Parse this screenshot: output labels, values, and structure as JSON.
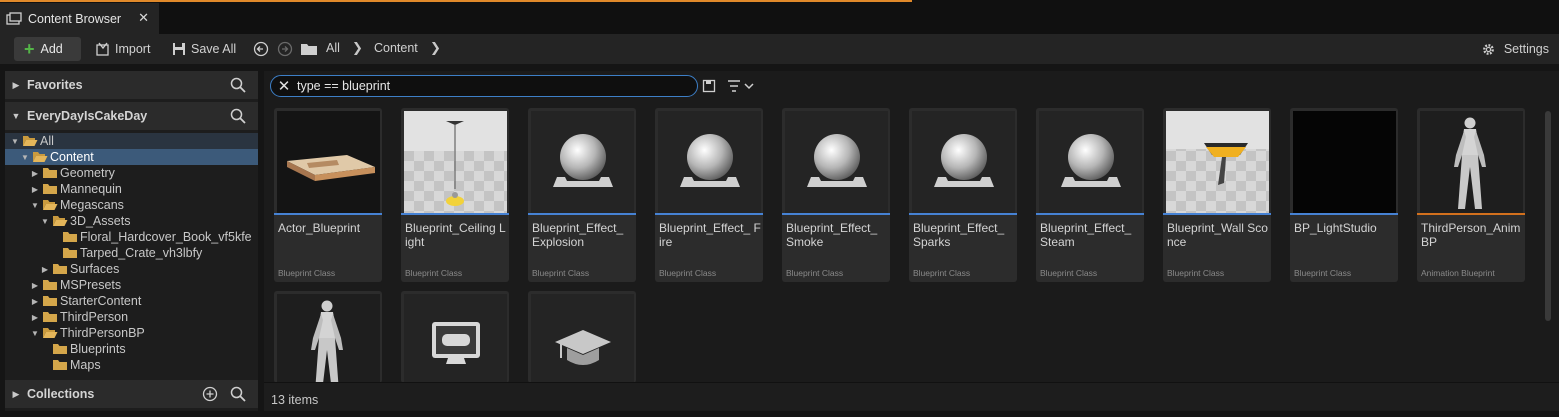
{
  "tab": {
    "title": "Content Browser",
    "close": "✕"
  },
  "toolbar": {
    "add": "Add",
    "import": "Import",
    "save_all": "Save All",
    "breadcrumb": [
      "All",
      "Content"
    ],
    "settings": "Settings"
  },
  "left": {
    "favorites": "Favorites",
    "project": "EveryDayIsCakeDay",
    "collections": "Collections",
    "tree": [
      {
        "label": "All",
        "depth": 0,
        "open": true
      },
      {
        "label": "Content",
        "depth": 1,
        "open": true
      },
      {
        "label": "Geometry",
        "depth": 2,
        "open": false
      },
      {
        "label": "Mannequin",
        "depth": 2,
        "open": false
      },
      {
        "label": "Megascans",
        "depth": 2,
        "open": true
      },
      {
        "label": "3D_Assets",
        "depth": 3,
        "open": true
      },
      {
        "label": "Floral_Hardcover_Book_vf5kfe",
        "depth": 4,
        "open": null
      },
      {
        "label": "Tarped_Crate_vh3lbfy",
        "depth": 4,
        "open": null
      },
      {
        "label": "Surfaces",
        "depth": 3,
        "open": false
      },
      {
        "label": "MSPresets",
        "depth": 2,
        "open": false
      },
      {
        "label": "StarterContent",
        "depth": 2,
        "open": false
      },
      {
        "label": "ThirdPerson",
        "depth": 2,
        "open": false
      },
      {
        "label": "ThirdPersonBP",
        "depth": 2,
        "open": true
      },
      {
        "label": "Blueprints",
        "depth": 3,
        "open": null
      },
      {
        "label": "Maps",
        "depth": 3,
        "open": null
      }
    ]
  },
  "search": {
    "value": "type == blueprint",
    "clear": "✕"
  },
  "assets": [
    {
      "name": "Actor_Blueprint",
      "type": "Blueprint Class",
      "thumb": "crate"
    },
    {
      "name": "Blueprint_Ceiling Light",
      "type": "Blueprint Class",
      "thumb": "ceiling"
    },
    {
      "name": "Blueprint_Effect_ Explosion",
      "type": "Blueprint Class",
      "thumb": "sphere"
    },
    {
      "name": "Blueprint_Effect_ Fire",
      "type": "Blueprint Class",
      "thumb": "sphere"
    },
    {
      "name": "Blueprint_Effect_ Smoke",
      "type": "Blueprint Class",
      "thumb": "sphere"
    },
    {
      "name": "Blueprint_Effect_ Sparks",
      "type": "Blueprint Class",
      "thumb": "sphere"
    },
    {
      "name": "Blueprint_Effect_ Steam",
      "type": "Blueprint Class",
      "thumb": "sphere"
    },
    {
      "name": "Blueprint_Wall Sconce",
      "type": "Blueprint Class",
      "thumb": "sconce"
    },
    {
      "name": "BP_LightStudio",
      "type": "Blueprint Class",
      "thumb": "black"
    },
    {
      "name": "ThirdPerson_Anim BP",
      "type": "Animation Blueprint",
      "thumb": "mannequin"
    },
    {
      "name": "",
      "type": "",
      "thumb": "mannequin"
    },
    {
      "name": "",
      "type": "",
      "thumb": "monitor"
    },
    {
      "name": "",
      "type": "",
      "thumb": "cap"
    }
  ],
  "status": {
    "count": "13 items"
  },
  "colors": {
    "accent": "#e0892a",
    "blueprint": "#4682d4",
    "anim": "#d2701d",
    "selection": "#3c5a7a"
  }
}
